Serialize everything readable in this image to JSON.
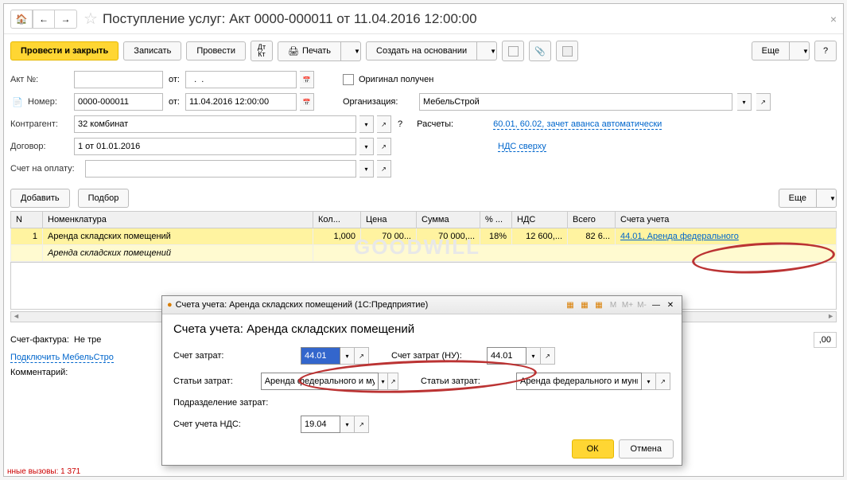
{
  "title": "Поступление услуг: Акт 0000-000011 от 11.04.2016 12:00:00",
  "toolbar": {
    "post_close": "Провести и закрыть",
    "save": "Записать",
    "post": "Провести",
    "print": "Печать",
    "create_based": "Создать на основании",
    "more": "Еще"
  },
  "form": {
    "act_label": "Акт №:",
    "act_value": "",
    "ot_label": "от:",
    "act_date": "  .  .",
    "num_label": "Номер:",
    "num_value": "0000-000011",
    "num_date": "11.04.2016 12:00:00",
    "contractor_label": "Контрагент:",
    "contractor_value": "32 комбинат",
    "contract_label": "Договор:",
    "contract_value": "1 от 01.01.2016",
    "invoice_label": "Счет на оплату:",
    "invoice_value": "",
    "original_label": "Оригинал получен",
    "org_label": "Организация:",
    "org_value": "МебельСтрой",
    "calc_label": "Расчеты:",
    "calc_link": "60.01, 60.02, зачет аванса автоматически",
    "vat_link": "НДС сверху"
  },
  "table_toolbar": {
    "add": "Добавить",
    "pick": "Подбор",
    "more": "Еще"
  },
  "table": {
    "headers": {
      "n": "N",
      "nom": "Номенклатура",
      "qty": "Кол...",
      "price": "Цена",
      "sum": "Сумма",
      "pct": "% ...",
      "vat": "НДС",
      "total": "Всего",
      "accts": "Счета учета"
    },
    "row": {
      "n": "1",
      "nom": "Аренда складских помещений",
      "nom2": "Аренда складских помещений",
      "qty": "1,000",
      "price": "70 00...",
      "sum": "70 000,...",
      "pct": "18%",
      "vat": "12 600,...",
      "total": "82 6...",
      "accts": "44.01, Аренда федерального"
    }
  },
  "footer": {
    "sf_label": "Счет-фактура:",
    "sf_value": "Не тре",
    "connect": "Подключить МебельСтро",
    "comment_label": "Комментарий:",
    "total_right": ",00"
  },
  "popup": {
    "titlebar": "Счета учета: Аренда складских помещений  (1С:Предприятие)",
    "title": "Счета учета: Аренда складских помещений",
    "cost_acc_label": "Счет затрат:",
    "cost_acc_value": "44.01",
    "cost_items_label": "Статьи затрат:",
    "cost_items_value": "Аренда федерального и мун",
    "dept_label": "Подразделение затрат:",
    "dept_value": "",
    "vat_acc_label": "Счет учета НДС:",
    "vat_acc_value": "19.04",
    "cost_acc_nu_label": "Счет затрат (НУ):",
    "cost_acc_nu_value": "44.01",
    "cost_items2_label": "Статьи затрат:",
    "cost_items2_value": "Аренда федерального и муни",
    "ok": "ОК",
    "cancel": "Отмена"
  },
  "status": "нные вызовы: 1 371",
  "watermark": "GOODWILL"
}
